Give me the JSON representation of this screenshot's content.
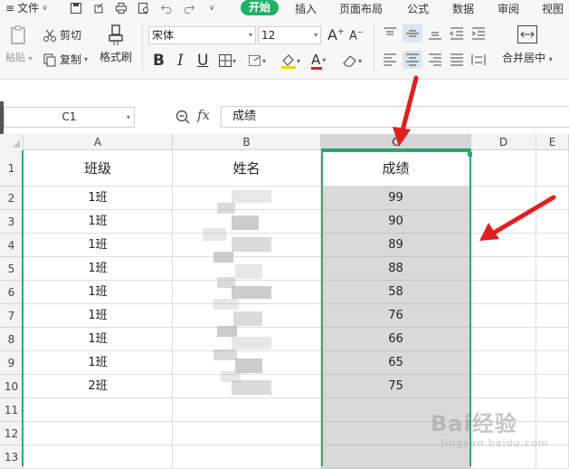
{
  "menubar": {
    "file_label": "文件",
    "tabs": [
      {
        "label": "开始",
        "active": true
      },
      {
        "label": "插入",
        "active": false
      },
      {
        "label": "页面布局",
        "active": false
      },
      {
        "label": "公式",
        "active": false
      },
      {
        "label": "数据",
        "active": false
      },
      {
        "label": "审阅",
        "active": false
      },
      {
        "label": "视图",
        "active": false
      }
    ]
  },
  "ribbon": {
    "paste_label": "粘贴",
    "cut_label": "剪切",
    "copy_label": "复制",
    "format_painter_label": "格式刷",
    "font_name": "宋体",
    "font_size": "12",
    "merge_center_label": "合并居中"
  },
  "formula_bar": {
    "name_box": "C1",
    "fx_label": "fx",
    "formula": "成绩"
  },
  "sheet": {
    "columns": [
      "A",
      "B",
      "C",
      "D",
      "E"
    ],
    "rows": [
      "1",
      "2",
      "3",
      "4",
      "5",
      "6",
      "7",
      "8",
      "9",
      "10",
      "11",
      "12",
      "13"
    ],
    "header": {
      "class": "班级",
      "name": "姓名",
      "score": "成绩"
    },
    "data": [
      {
        "class": "1班",
        "score": "99"
      },
      {
        "class": "1班",
        "score": "90"
      },
      {
        "class": "1班",
        "score": "89"
      },
      {
        "class": "1班",
        "score": "88"
      },
      {
        "class": "1班",
        "score": "58"
      },
      {
        "class": "1班",
        "score": "76"
      },
      {
        "class": "1班",
        "score": "66"
      },
      {
        "class": "1班",
        "score": "65"
      },
      {
        "class": "2班",
        "score": "75"
      }
    ],
    "selected_column": "C"
  },
  "watermark": {
    "main": "Bai经验",
    "sub": "jingyan.baidu.com"
  },
  "colors": {
    "accent": "#20b067",
    "selection": "#2aac6d",
    "arrow": "#e02020"
  }
}
